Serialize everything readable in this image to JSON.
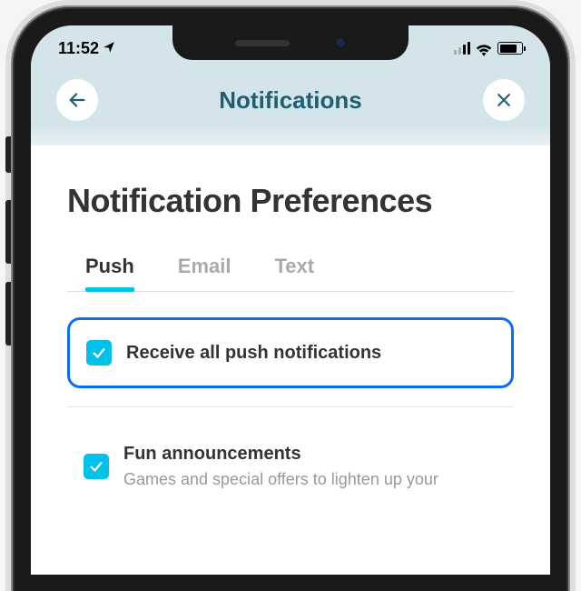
{
  "status": {
    "time": "11:52"
  },
  "header": {
    "title": "Notifications"
  },
  "page": {
    "title": "Notification Preferences"
  },
  "tabs": [
    {
      "label": "Push",
      "active": true
    },
    {
      "label": "Email",
      "active": false
    },
    {
      "label": "Text",
      "active": false
    }
  ],
  "options": {
    "receive_all": {
      "label": "Receive all push notifications",
      "checked": true
    },
    "fun": {
      "label": "Fun announcements",
      "desc": "Games and special offers to lighten up your",
      "checked": true
    }
  }
}
